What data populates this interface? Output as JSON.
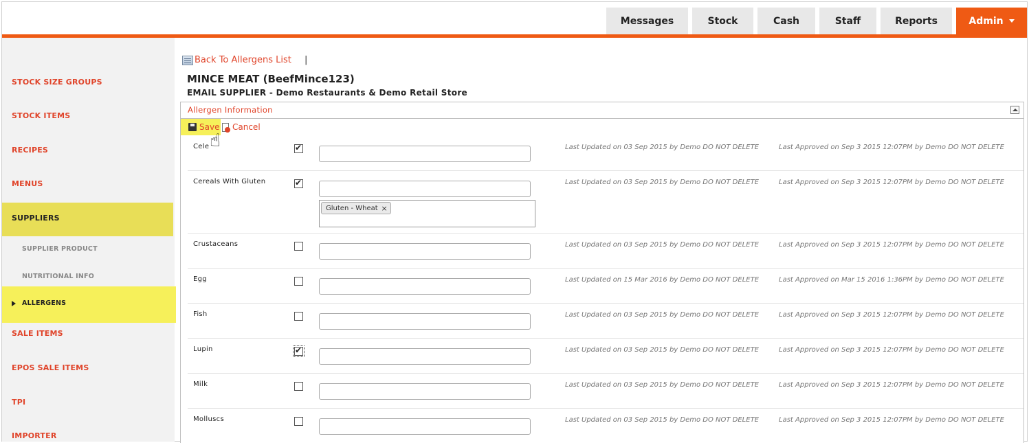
{
  "nav": {
    "tabs": [
      {
        "label": "Messages"
      },
      {
        "label": "Stock"
      },
      {
        "label": "Cash"
      },
      {
        "label": "Staff"
      },
      {
        "label": "Reports"
      },
      {
        "label": "Admin"
      }
    ]
  },
  "sidebar": {
    "items": [
      {
        "label": "STOCK SIZE GROUPS"
      },
      {
        "label": "STOCK ITEMS"
      },
      {
        "label": "RECIPES"
      },
      {
        "label": "MENUS"
      },
      {
        "label": "SUPPLIERS"
      },
      {
        "label": "SUPPLIER PRODUCT"
      },
      {
        "label": "NUTRITIONAL INFO"
      },
      {
        "label": "ALLERGENS"
      },
      {
        "label": "SALE ITEMS"
      },
      {
        "label": "EPOS SALE ITEMS"
      },
      {
        "label": "TPI"
      },
      {
        "label": "IMPORTER"
      }
    ]
  },
  "main": {
    "back_link": "Back To Allergens List",
    "separator": "|",
    "title": "MINCE MEAT (BeefMince123)",
    "subtitle": "EMAIL SUPPLIER - Demo Restaurants & Demo Retail Store",
    "panel_title": "Allergen Information",
    "save_label": "Save",
    "cancel_label": "Cancel"
  },
  "allergens": [
    {
      "name": "Cele",
      "checked": true,
      "updated": "Last Updated on 03 Sep 2015 by Demo DO NOT DELETE",
      "approved": "Last Approved on Sep 3 2015 12:07PM by Demo DO NOT DELETE"
    },
    {
      "name": "Cereals With Gluten",
      "checked": true,
      "tag": "Gluten - Wheat",
      "updated": "Last Updated on 03 Sep 2015 by Demo DO NOT DELETE",
      "approved": "Last Approved on Sep 3 2015 12:07PM by Demo DO NOT DELETE"
    },
    {
      "name": "Crustaceans",
      "checked": false,
      "updated": "Last Updated on 03 Sep 2015 by Demo DO NOT DELETE",
      "approved": "Last Approved on Sep 3 2015 12:07PM by Demo DO NOT DELETE"
    },
    {
      "name": "Egg",
      "checked": false,
      "updated": "Last Updated on 15 Mar 2016 by Demo DO NOT DELETE",
      "approved": "Last Approved on Mar 15 2016 1:36PM by Demo DO NOT DELETE"
    },
    {
      "name": "Fish",
      "checked": false,
      "updated": "Last Updated on 03 Sep 2015 by Demo DO NOT DELETE",
      "approved": "Last Approved on Sep 3 2015 12:07PM by Demo DO NOT DELETE"
    },
    {
      "name": "Lupin",
      "checked": true,
      "updated": "Last Updated on 03 Sep 2015 by Demo DO NOT DELETE",
      "approved": "Last Approved on Sep 3 2015 12:07PM by Demo DO NOT DELETE"
    },
    {
      "name": "Milk",
      "checked": false,
      "updated": "Last Updated on 03 Sep 2015 by Demo DO NOT DELETE",
      "approved": "Last Approved on Sep 3 2015 12:07PM by Demo DO NOT DELETE"
    },
    {
      "name": "Molluscs",
      "checked": false,
      "updated": "Last Updated on 03 Sep 2015 by Demo DO NOT DELETE",
      "approved": "Last Approved on Sep 3 2015 12:07PM by Demo DO NOT DELETE"
    }
  ],
  "colors": {
    "accent": "#ef5a14",
    "link": "#e0442a",
    "highlight": "#f6f05a",
    "suppliers_highlight": "#e8de57"
  }
}
